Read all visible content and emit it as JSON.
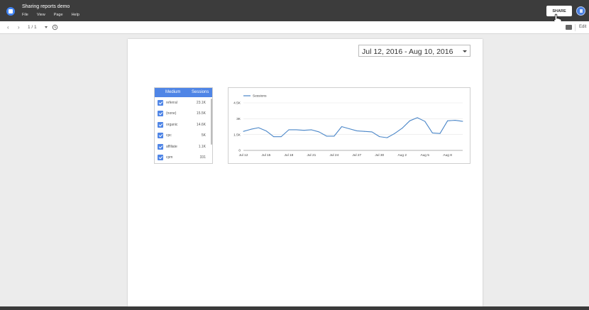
{
  "app": {
    "title": "Sharing reports demo",
    "menu": [
      "File",
      "View",
      "Page",
      "Help"
    ],
    "share_label": "SHARE"
  },
  "toolbar": {
    "prev_glyph": "‹",
    "next_glyph": "›",
    "page_indicator": "1 / 1",
    "edit_label": "Edit"
  },
  "report": {
    "date_range": "Jul 12, 2016 - Aug 10, 2016",
    "table": {
      "headers": [
        "Medium",
        "Sessions"
      ],
      "rows": [
        {
          "label": "referral",
          "value": "23.1K"
        },
        {
          "label": "(none)",
          "value": "15.5K"
        },
        {
          "label": "organic",
          "value": "14.6K"
        },
        {
          "label": "cpc",
          "value": "5K"
        },
        {
          "label": "affiliate",
          "value": "1.1K"
        },
        {
          "label": "cpm",
          "value": "331"
        }
      ]
    }
  },
  "chart_data": {
    "type": "line",
    "legend": "Sessions",
    "legend_position": "top-left",
    "grid": true,
    "ylim": [
      0,
      4500
    ],
    "y_ticks": [
      0,
      1500,
      3000,
      4500
    ],
    "y_tick_labels": [
      "0",
      "1.5K",
      "3K",
      "4.5K"
    ],
    "x": [
      "Jul 12",
      "Jul 13",
      "Jul 14",
      "Jul 15",
      "Jul 16",
      "Jul 17",
      "Jul 18",
      "Jul 19",
      "Jul 20",
      "Jul 21",
      "Jul 22",
      "Jul 23",
      "Jul 24",
      "Jul 25",
      "Jul 26",
      "Jul 27",
      "Jul 28",
      "Jul 29",
      "Jul 30",
      "Jul 31",
      "Aug 1",
      "Aug 2",
      "Aug 3",
      "Aug 4",
      "Aug 5",
      "Aug 6",
      "Aug 7",
      "Aug 8",
      "Aug 9",
      "Aug 10"
    ],
    "x_tick_labels": [
      "Jul 12",
      "Jul 15",
      "Jul 18",
      "Jul 21",
      "Jul 24",
      "Jul 27",
      "Jul 30",
      "Aug 2",
      "Aug 5",
      "Aug 8"
    ],
    "series": [
      {
        "name": "Sessions",
        "values": [
          1800,
          2000,
          2150,
          1850,
          1300,
          1300,
          1950,
          1950,
          1900,
          1950,
          1750,
          1350,
          1350,
          2250,
          2050,
          1850,
          1800,
          1750,
          1300,
          1200,
          1600,
          2100,
          2800,
          3100,
          2750,
          1650,
          1600,
          2800,
          2850,
          2750
        ]
      }
    ],
    "colors": {
      "line": "#4a86c8",
      "grid": "#e5e5e5"
    }
  }
}
